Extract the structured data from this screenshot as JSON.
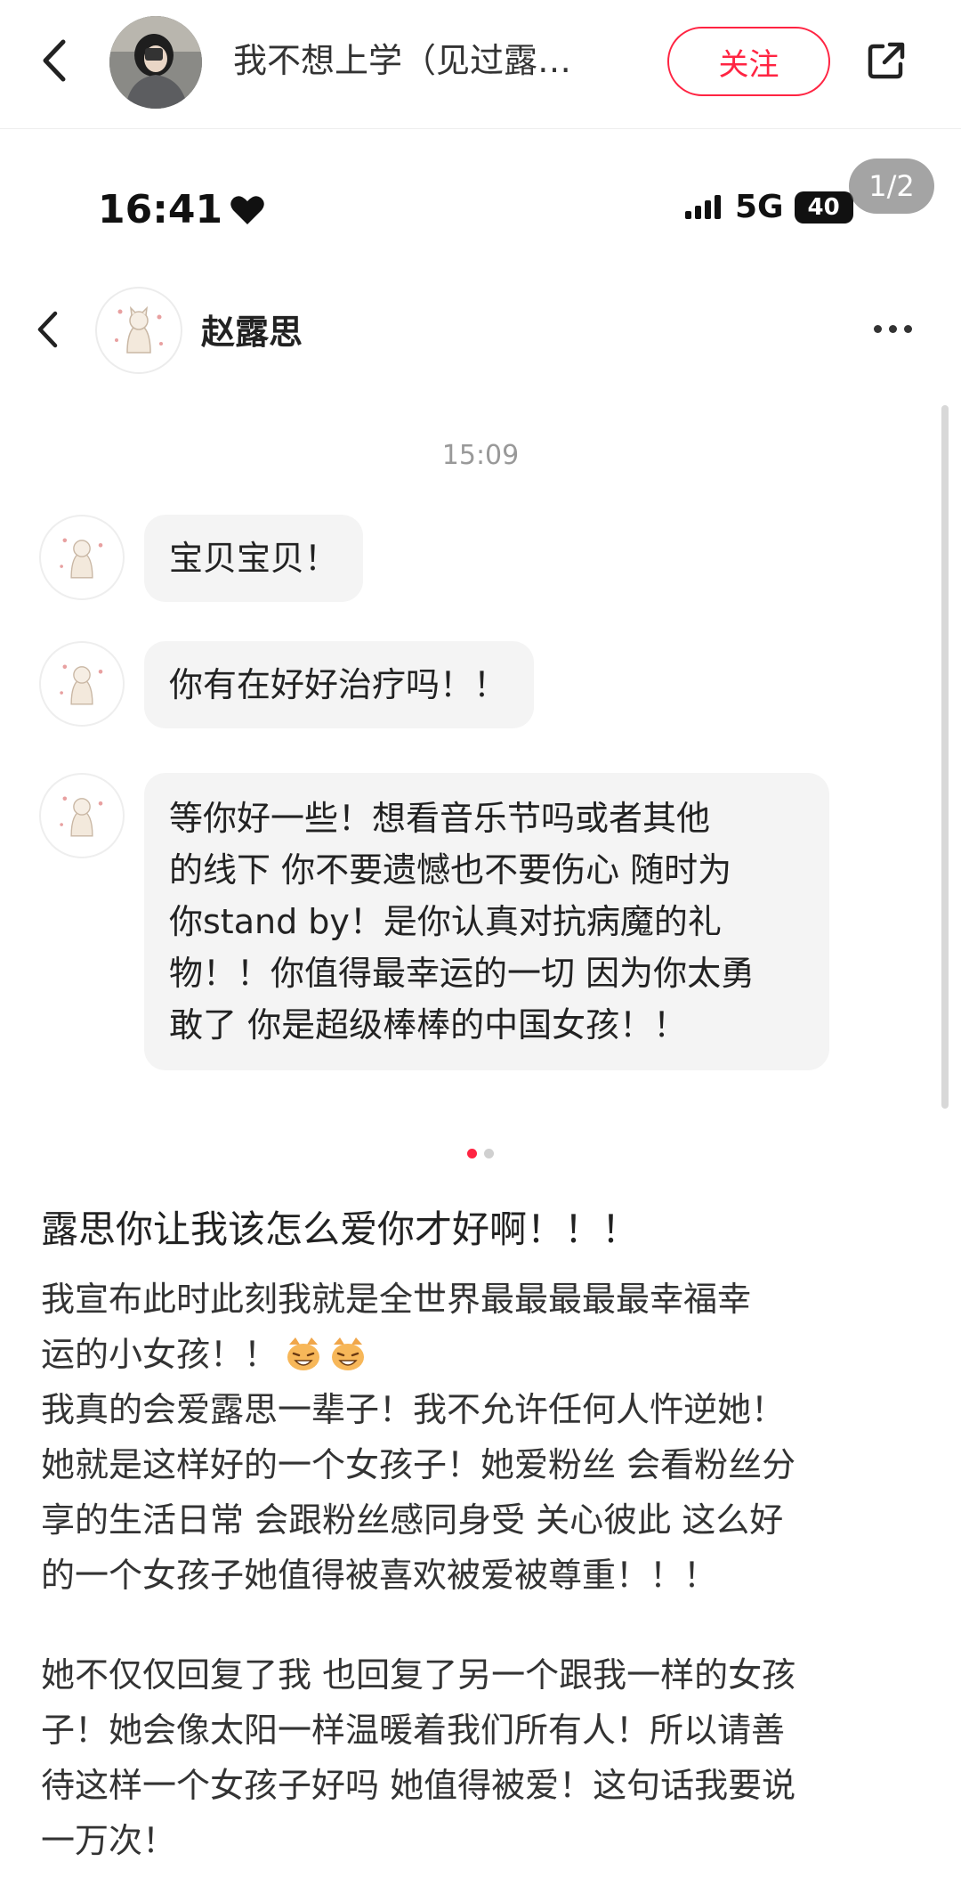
{
  "topbar": {
    "author_name": "我不想上学（见过露…",
    "follow_label": "关注"
  },
  "screenshot": {
    "status_time": "16:41",
    "network": "5G",
    "battery": "40",
    "pager": "1/2",
    "chat_name": "赵露思",
    "timestamp": "15:09",
    "messages": [
      "宝贝宝贝！",
      "你有在好好治疗吗！！",
      "等你好一些！想看音乐节吗或者其他的线下 你不要遗憾也不要伤心 随时为你stand by！是你认真对抗病魔的礼物！！你值得最幸运的一切 因为你太勇敢了 你是超级棒棒的中国女孩！！"
    ],
    "message3_lines": [
      "等你好一些！想看音乐节吗或者其他",
      "的线下 你不要遗憾也不要伤心 随时为",
      "你stand by！是你认真对抗病魔的礼",
      "物！！你值得最幸运的一切 因为你太勇",
      "敢了 你是超级棒棒的中国女孩！！"
    ]
  },
  "carousel": {
    "total": 2,
    "active": 1
  },
  "post": {
    "title": "露思你让我该怎么爱你才好啊！！！",
    "para1_lines": [
      "我宣布此时此刻我就是全世界最最最最最幸福幸",
      "运的小女孩！！",
      "我真的会爱露思一辈子！我不允许任何人忤逆她！",
      "她就是这样好的一个女孩子！她爱粉丝 会看粉丝分",
      "享的生活日常 会跟粉丝感同身受 关心彼此 这么好",
      "的一个女孩子她值得被喜欢被爱被尊重！！！"
    ],
    "para2_lines": [
      "她不仅仅回复了我 也回复了另一个跟我一样的女孩",
      "子！她会像太阳一样温暖着我们所有人！所以请善",
      "待这样一个女孩子好吗 她值得被爱！这句话我要说",
      "一万次！"
    ],
    "emojis": [
      "grinning-cat-emoji",
      "grinning-cat-emoji"
    ]
  },
  "colors": {
    "accent": "#ff2442",
    "bubble": "#f4f4f4",
    "muted": "#999999"
  }
}
